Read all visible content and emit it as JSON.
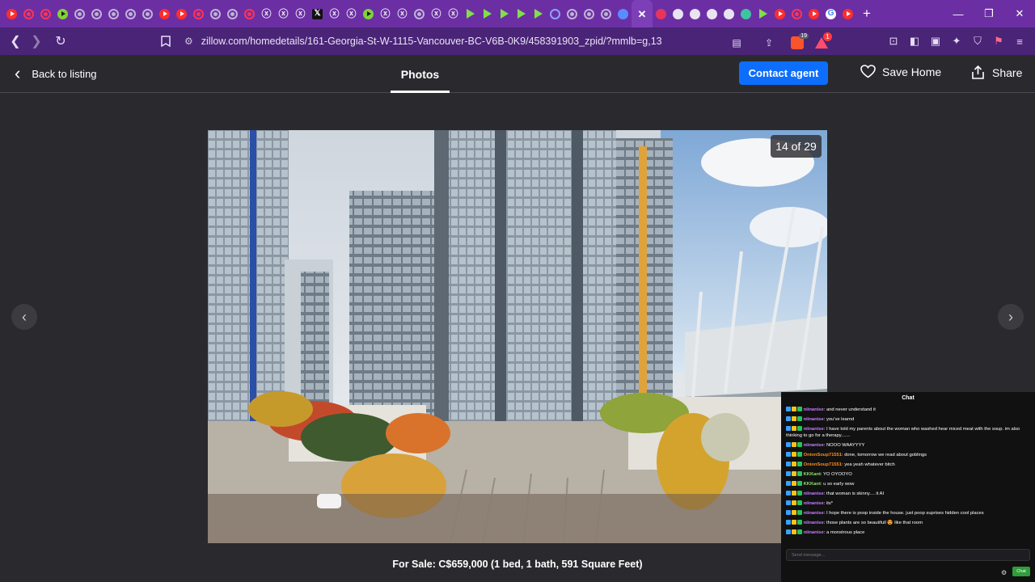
{
  "browser": {
    "tabs": [
      {
        "icon": "yt"
      },
      {
        "icon": "ytr"
      },
      {
        "icon": "ytr"
      },
      {
        "icon": "gr"
      },
      {
        "icon": "gray"
      },
      {
        "icon": "gray"
      },
      {
        "icon": "gray"
      },
      {
        "icon": "gray"
      },
      {
        "icon": "gray"
      },
      {
        "icon": "yt"
      },
      {
        "icon": "yt"
      },
      {
        "icon": "ytr"
      },
      {
        "icon": "gray"
      },
      {
        "icon": "gray"
      },
      {
        "icon": "ytr"
      },
      {
        "icon": "x"
      },
      {
        "icon": "x"
      },
      {
        "icon": "x"
      },
      {
        "icon": "xb"
      },
      {
        "icon": "x"
      },
      {
        "icon": "x"
      },
      {
        "icon": "gr"
      },
      {
        "icon": "x"
      },
      {
        "icon": "x"
      },
      {
        "icon": "gray"
      },
      {
        "icon": "x"
      },
      {
        "icon": "x"
      },
      {
        "icon": "play"
      },
      {
        "icon": "play"
      },
      {
        "icon": "play"
      },
      {
        "icon": "play"
      },
      {
        "icon": "play"
      },
      {
        "icon": "ring"
      },
      {
        "icon": "gray"
      },
      {
        "icon": "gray"
      },
      {
        "icon": "gray"
      },
      {
        "icon": "blue"
      },
      {
        "icon": "close",
        "active": true
      },
      {
        "icon": "red"
      },
      {
        "icon": "wh"
      },
      {
        "icon": "wh"
      },
      {
        "icon": "wh"
      },
      {
        "icon": "wh"
      },
      {
        "icon": "pin"
      },
      {
        "icon": "play"
      },
      {
        "icon": "yt"
      },
      {
        "icon": "ytr"
      },
      {
        "icon": "yt"
      },
      {
        "icon": "g"
      },
      {
        "icon": "yt"
      }
    ],
    "url": "zillow.com/homedetails/161-Georgia-St-W-1115-Vancouver-BC-V6B-0K9/458391903_zpid/?mmlb=g,13",
    "brave_badge": "19",
    "rewards_badge": "1"
  },
  "header": {
    "back_label": "Back to listing",
    "photos_tab": "Photos",
    "contact_label": "Contact agent",
    "save_label": "Save Home",
    "share_label": "Share"
  },
  "gallery": {
    "counter": "14 of 29",
    "caption": "For Sale: C$659,000 (1 bed, 1 bath, 591 Square Feet)"
  },
  "chat": {
    "title": "Chat",
    "input_placeholder": "Send message...",
    "send_label": "Chat",
    "colors": {
      "ninanise": "#c77dff",
      "OnionSoup71551": "#ff8c1a",
      "KKKant": "#8fe36a"
    },
    "messages": [
      {
        "user": "niinanise",
        "text": ": and never understand it",
        "color": "#c77dff"
      },
      {
        "user": "niinanise",
        "text": ": you've learnd",
        "color": "#c77dff"
      },
      {
        "user": "niinanise",
        "text": ": I have told my parents about the woman who washed hear miced meat with the soup. im also thinking to go for a therapy.......",
        "color": "#c77dff"
      },
      {
        "user": "niinanise",
        "text": ": NOOO WAAYYYY",
        "color": "#c77dff"
      },
      {
        "user": "OnionSoup71551",
        "text": ": done, tomorrow we read about goblings",
        "color": "#ff8c1a"
      },
      {
        "user": "OnionSoup71551",
        "text": ": yea yeah whatever bitch",
        "color": "#ff8c1a"
      },
      {
        "user": "KKKant",
        "text": ": YO OYOOYO",
        "color": "#8fe36a"
      },
      {
        "user": "KKKant",
        "text": ": u so early wow",
        "color": "#8fe36a"
      },
      {
        "user": "niinanise",
        "text": ": that woman is skinny.... it AI",
        "color": "#c77dff"
      },
      {
        "user": "niinanise",
        "text": ": its*",
        "color": "#c77dff"
      },
      {
        "user": "niinanise",
        "text": ": I hope there is poop inside the house. just poop suprises hidden cool places",
        "color": "#c77dff"
      },
      {
        "user": "niinanise",
        "text": ": those plants are so beautifull 😍 like that room",
        "color": "#c77dff"
      },
      {
        "user": "niinanise",
        "text": ": a monstrous place",
        "color": "#c77dff"
      }
    ]
  }
}
